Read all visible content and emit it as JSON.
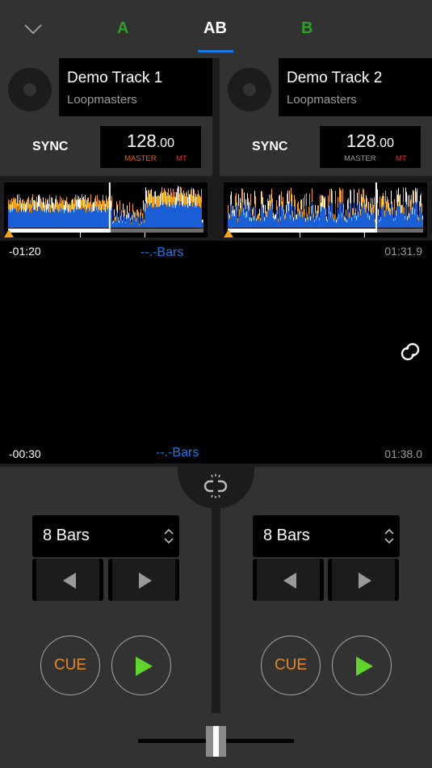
{
  "topbar": {
    "collapse_icon": "chevron-down-icon",
    "tabs": [
      {
        "label": "A",
        "color": "#2ea02a",
        "active": false
      },
      {
        "label": "AB",
        "color": "#ffffff",
        "active": true
      },
      {
        "label": "B",
        "color": "#2ea02a",
        "active": false
      }
    ],
    "accent_color": "#1f7ae0"
  },
  "decks": [
    {
      "id": "A",
      "title": "Demo Track 1",
      "artist": "Loopmasters",
      "sync_label": "SYNC",
      "bpm_int": "128",
      "bpm_dec": ".00",
      "master_label": "MASTER",
      "master_color": "#e8651f",
      "mt_label": "MT",
      "mt_color": "#e03a2e",
      "overview_progress": 0.52,
      "time_remaining": "-01:20",
      "bars": "--.-Bars",
      "loop_size": "8 Bars",
      "cue_label": "CUE"
    },
    {
      "id": "B",
      "title": "Demo Track 2",
      "artist": "Loopmasters",
      "sync_label": "SYNC",
      "bpm_int": "128",
      "bpm_dec": ".00",
      "master_label": "MASTER",
      "master_color": "#9a9a9a",
      "mt_label": "MT",
      "mt_color": "#e03a2e",
      "overview_progress": 0.76,
      "time_remaining": "-00:30",
      "bars": "--.-Bars",
      "loop_size": "8 Bars",
      "cue_label": "CUE"
    }
  ],
  "main_wave": {
    "deck_a_elapsed": "01:31.9",
    "deck_b_elapsed": "01:38.0",
    "link_icon": "link-rings-icon"
  },
  "mixer": {
    "center_icon": "unlink-icon",
    "crossfader_position": 0.5
  },
  "colors": {
    "wave_blue": "#1a5fd6",
    "wave_orange": "#f5a21a",
    "cue_orange": "#e58a1f",
    "play_green": "#5fd42a"
  }
}
